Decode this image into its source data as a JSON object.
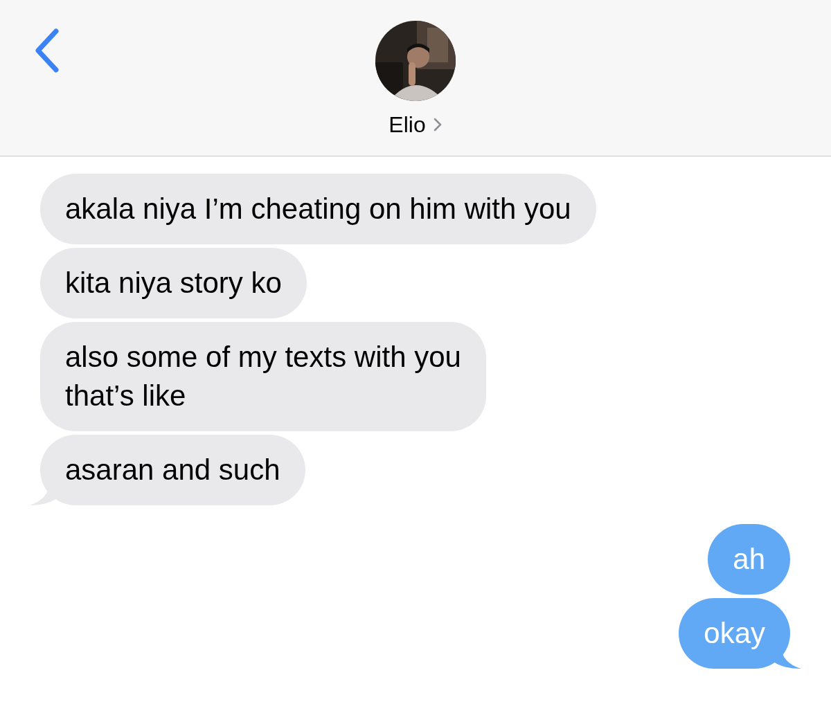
{
  "header": {
    "contact_name": "Elio"
  },
  "messages": [
    {
      "text": "akala niya I’m cheating on him with you",
      "kind": "received",
      "tail": false
    },
    {
      "text": "kita niya story ko",
      "kind": "received",
      "tail": false
    },
    {
      "text": "also some of my texts with you\nthat’s like",
      "kind": "received",
      "tail": false
    },
    {
      "text": "asaran and such",
      "kind": "received",
      "tail": true
    },
    {
      "text": "ah",
      "kind": "sent",
      "tail": false
    },
    {
      "text": "okay",
      "kind": "sent",
      "tail": true
    }
  ]
}
